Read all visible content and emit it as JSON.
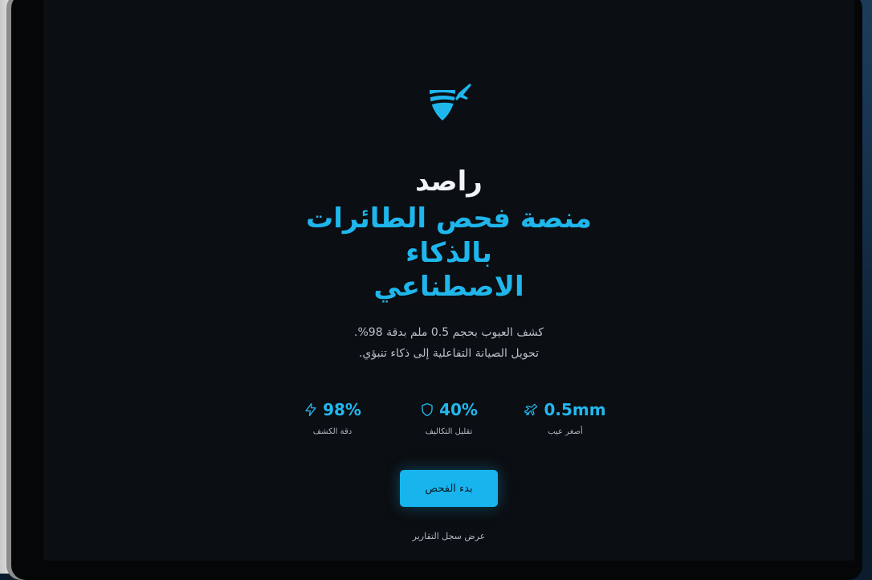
{
  "brand": {
    "name": "راصد",
    "logo_icon": "shield-airplane-icon"
  },
  "hero": {
    "headline_line1": "منصة فحص الطائرات بالذكاء",
    "headline_line2": "الاصطناعي",
    "subtitle_line1": "كشف العيوب بحجم 0.5 ملم بدقة 98%.",
    "subtitle_line2": "تحويل الصيانة التفاعلية إلى ذكاء تنبؤي."
  },
  "stats": [
    {
      "value": "0.5mm",
      "label": "أصغر عيب",
      "icon": "airplane-icon"
    },
    {
      "value": "40%",
      "label": "تقليل التكاليف",
      "icon": "shield-icon"
    },
    {
      "value": "98%",
      "label": "دقة الكشف",
      "icon": "lightning-icon"
    }
  ],
  "actions": {
    "start_label": "بدء الفحص",
    "reports_label": "عرض سجل التقارير"
  },
  "colors": {
    "accent": "#1fb6ec",
    "background": "#0b0e12",
    "text_muted": "#aeb7c1"
  }
}
